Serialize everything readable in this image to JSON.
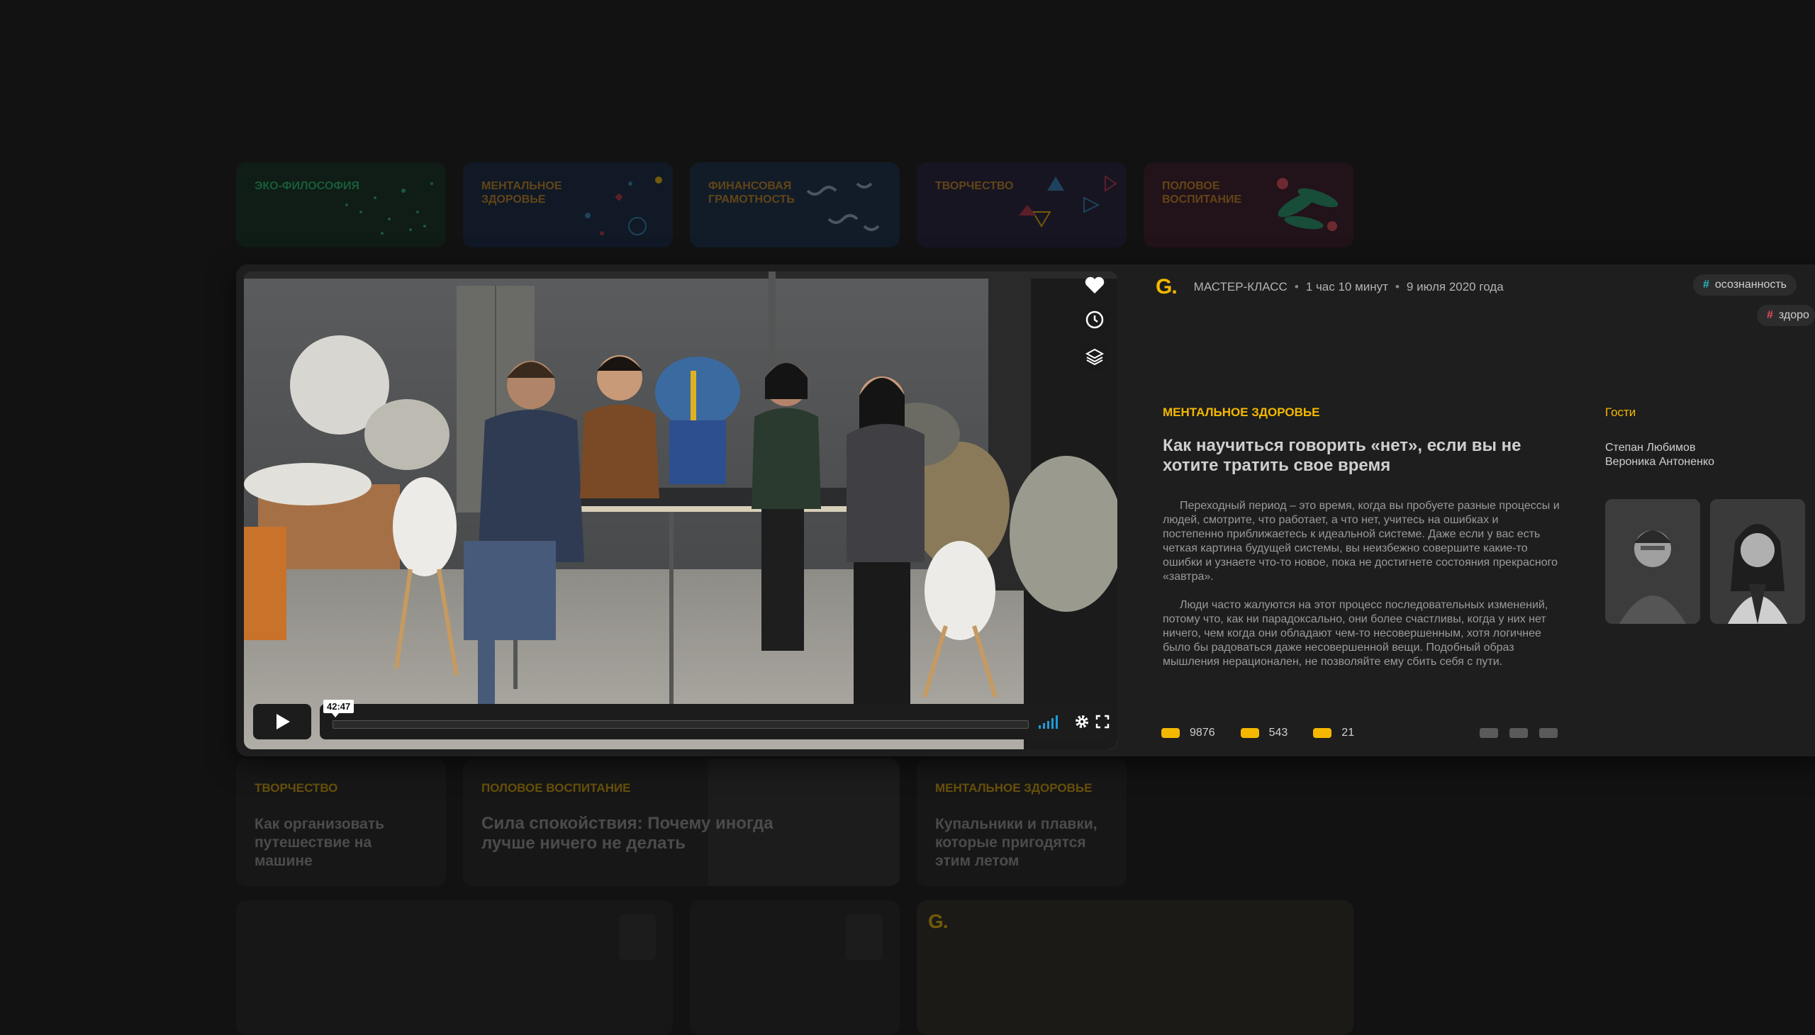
{
  "categories": [
    {
      "label": "Эко-философия",
      "color": "#16a060"
    },
    {
      "label": "Ментальное здоровье",
      "color": "#2f86c0"
    },
    {
      "label": "Финансовая грамотность",
      "color": "#3a78c8"
    },
    {
      "label": "Творчество",
      "color": "#6a4ac0"
    },
    {
      "label": "Половое воспитание",
      "color": "#c0304a"
    }
  ],
  "bg_cards": [
    {
      "category": "Творчество",
      "title": "Как организовать путешествие на машине"
    },
    {
      "category": "Половое воспитание",
      "title": "Сила спокойствия: Почему иногда лучше ничего не делать"
    },
    {
      "category": "Ментальное здоровье",
      "title": "Купальники и плавки, которые пригодятся этим летом"
    }
  ],
  "bg_row2_logo": "G.",
  "video": {
    "current_time": "42:47",
    "progress": 0.0
  },
  "side_actions": {
    "like_icon": "heart-icon",
    "watch_later_icon": "clock-icon",
    "playlist_icon": "layers-icon"
  },
  "meta": {
    "logo": "G.",
    "type": "МАСТЕР-КЛАСС",
    "duration": "1 час 10 минут",
    "date": "9 июля 2020 года"
  },
  "tags": [
    "осознанность",
    "здоро"
  ],
  "article": {
    "category": "МЕНТАЛЬНОЕ ЗДОРОВЬЕ",
    "title": "Как научиться говорить «нет», если вы не хотите тратить свое время",
    "paragraphs": [
      "Переходный период – это время, когда вы пробуете разные процессы и людей, смотрите, что работает, а что нет, учитесь на ошибках и постепенно приближаетесь к идеальной системе. Даже если у вас есть четкая картина будущей системы, вы неизбежно совершите какие-то ошибки и узнаете что-то новое, пока не достигнете состояния прекрасного «завтра».",
      "Люди часто жалуются на этот процесс последовательных изменений, потому что, как ни парадоксально, они более счастливы, когда у них нет ничего, чем когда они обладают чем-то несовершенным, хотя логичнее было бы радоваться даже несовершенной вещи. Подобный образ мышления нерационален, не позволяйте ему сбить себя с пути."
    ]
  },
  "guests": {
    "label": "Гости",
    "names": [
      "Степан Любимов",
      "Вероника Антоненко"
    ]
  },
  "stats": [
    "9876",
    "543",
    "21"
  ],
  "colors": {
    "accent": "#f5b800",
    "tag_teal": "#26b8c8",
    "tag_red": "#e84b5a"
  }
}
